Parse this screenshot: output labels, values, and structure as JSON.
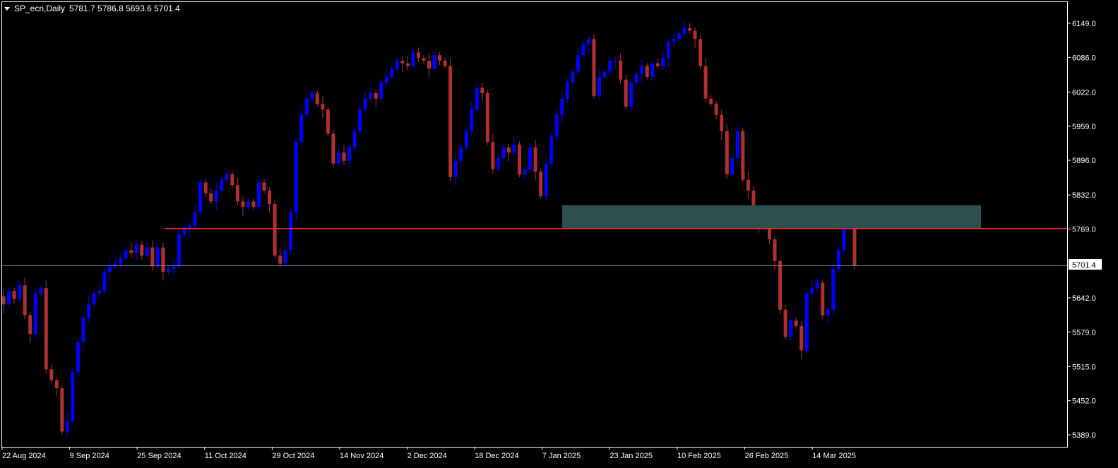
{
  "header": {
    "symbol_timeframe": "SP_ecn,Daily",
    "ohlc": "5781.7 5786.8 5693.6 5701.4"
  },
  "current_price": {
    "label": "5701.4",
    "value": 5701.4
  },
  "colors": {
    "background": "#000000",
    "frame": "#ffffff",
    "bull": "#0000ff",
    "bear": "#b03030",
    "level_line": "#ff2a2a",
    "price_line": "#6f8aa0",
    "zone": "#2f4f4f"
  },
  "chart_data": {
    "type": "candlestick",
    "y_ticks": [
      "6149.0",
      "6086.0",
      "6022.0",
      "5959.0",
      "5896.0",
      "5832.0",
      "5769.0",
      "5642.0",
      "5579.0",
      "5515.0",
      "5452.0",
      "5389.0"
    ],
    "x_ticks": [
      "22 Aug 2024",
      "9 Sep 2024",
      "25 Sep 2024",
      "11 Oct 2024",
      "29 Oct 2024",
      "14 Nov 2024",
      "2 Dec 2024",
      "18 Dec 2024",
      "7 Jan 2025",
      "23 Jan 2025",
      "10 Feb 2025",
      "26 Feb 2025",
      "14 Mar 2025"
    ],
    "ylim": [
      5378,
      6178
    ],
    "horizontal_level": 5770,
    "zone": {
      "low": 5770,
      "high": 5813
    },
    "ohlc_closes": [
      5630,
      5655,
      5640,
      5665,
      5610,
      5575,
      5650,
      5660,
      5510,
      5490,
      5475,
      5395,
      5415,
      5505,
      5560,
      5605,
      5630,
      5650,
      5655,
      5690,
      5700,
      5705,
      5715,
      5730,
      5725,
      5740,
      5720,
      5735,
      5700,
      5735,
      5690,
      5695,
      5700,
      5760,
      5770,
      5775,
      5800,
      5855,
      5835,
      5820,
      5840,
      5860,
      5870,
      5850,
      5820,
      5810,
      5820,
      5810,
      5855,
      5840,
      5815,
      5720,
      5705,
      5730,
      5800,
      5930,
      5980,
      6010,
      6020,
      6000,
      5990,
      5945,
      5890,
      5910,
      5895,
      5920,
      5950,
      5990,
      6010,
      6020,
      6010,
      6040,
      6050,
      6065,
      6080,
      6075,
      6070,
      6095,
      6085,
      6080,
      6065,
      6090,
      6080,
      6070,
      5865,
      5895,
      5920,
      5950,
      5990,
      6030,
      6020,
      5930,
      5880,
      5900,
      5920,
      5910,
      5925,
      5870,
      5880,
      5920,
      5875,
      5830,
      5890,
      5940,
      5980,
      6010,
      6040,
      6060,
      6090,
      6110,
      6120,
      6015,
      6050,
      6060,
      6080,
      6080,
      6045,
      5995,
      6040,
      6055,
      6070,
      6050,
      6075,
      6070,
      6085,
      6115,
      6120,
      6130,
      6140,
      6135,
      6120,
      6070,
      6010,
      6000,
      5980,
      5950,
      5870,
      5900,
      5950,
      5860,
      5840,
      5800,
      5770,
      5775,
      5750,
      5710,
      5620,
      5570,
      5600,
      5590,
      5545,
      5650,
      5660,
      5670,
      5610,
      5620,
      5695,
      5730,
      5770,
      5785,
      5701
    ]
  }
}
